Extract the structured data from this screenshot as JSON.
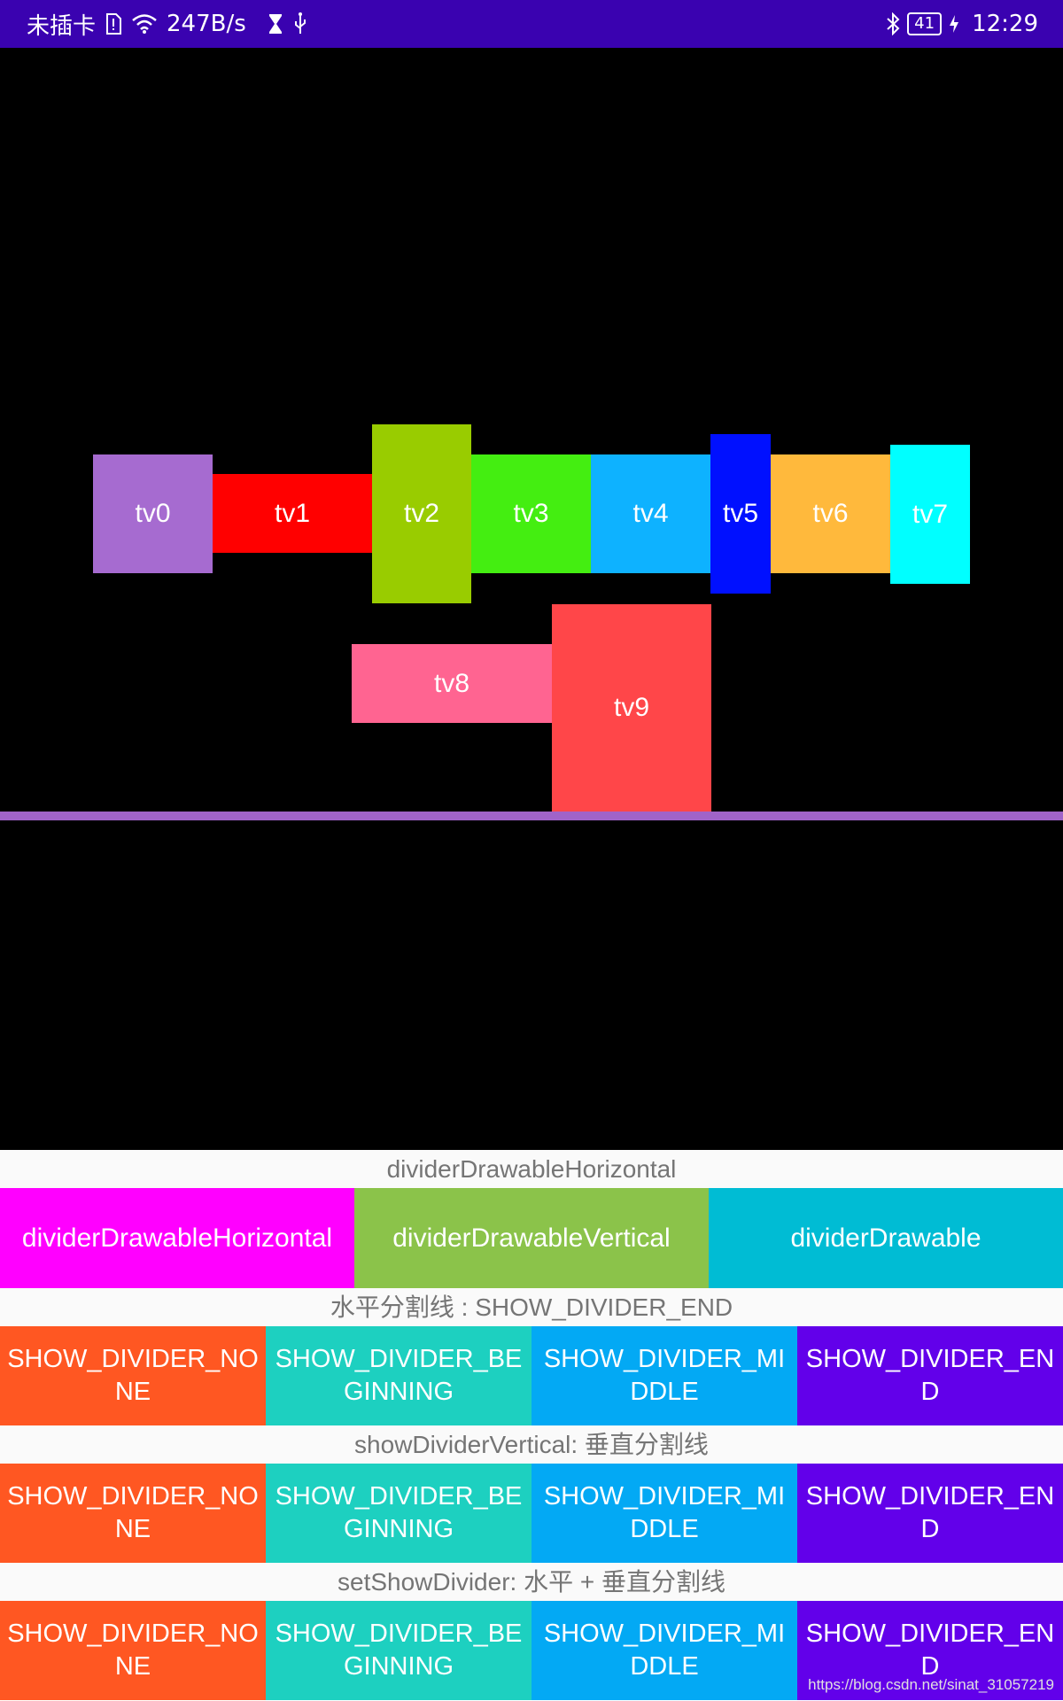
{
  "status_bar": {
    "carrier": "未插卡",
    "net_speed": "247B/s",
    "battery": "41",
    "time": "12:29",
    "icons": [
      "sim-alert-icon",
      "wifi-icon",
      "hourglass-icon",
      "usb-icon",
      "bluetooth-icon",
      "charging-icon"
    ]
  },
  "flex_items": {
    "tv0": {
      "label": "tv0",
      "color": "#a66bd0"
    },
    "tv1": {
      "label": "tv1",
      "color": "#ff0000"
    },
    "tv2": {
      "label": "tv2",
      "color": "#99cc00"
    },
    "tv3": {
      "label": "tv3",
      "color": "#44ee11"
    },
    "tv4": {
      "label": "tv4",
      "color": "#0eb2ff"
    },
    "tv5": {
      "label": "tv5",
      "color": "#0010ff"
    },
    "tv6": {
      "label": "tv6",
      "color": "#ffb93c"
    },
    "tv7": {
      "label": "tv7",
      "color": "#00ffff"
    },
    "tv8": {
      "label": "tv8",
      "color": "#ff6491"
    },
    "tv9": {
      "label": "tv9",
      "color": "#ff4649"
    }
  },
  "controls": {
    "section1_label": "dividerDrawableHorizontal",
    "drawable_buttons": [
      {
        "label": "dividerDrawableHorizontal",
        "color": "#ff00ff"
      },
      {
        "label": "dividerDrawableVertical",
        "color": "#8bc34a"
      },
      {
        "label": "dividerDrawable",
        "color": "#00bcd4"
      }
    ],
    "section2_label": "水平分割线 : SHOW_DIVIDER_END",
    "section3_label": "showDividerVertical: 垂直分割线",
    "section4_label": "setShowDivider: 水平 + 垂直分割线",
    "divider_buttons": [
      {
        "label": "SHOW_DIVIDER_NONE",
        "color": "#ff5722"
      },
      {
        "label": "SHOW_DIVIDER_BEGINNING",
        "color": "#1dd0c0"
      },
      {
        "label": "SHOW_DIVIDER_MIDDLE",
        "color": "#03a9f4"
      },
      {
        "label": "SHOW_DIVIDER_END",
        "color": "#6200ea"
      }
    ]
  },
  "watermark": "https://blog.csdn.net/sinat_31057219"
}
